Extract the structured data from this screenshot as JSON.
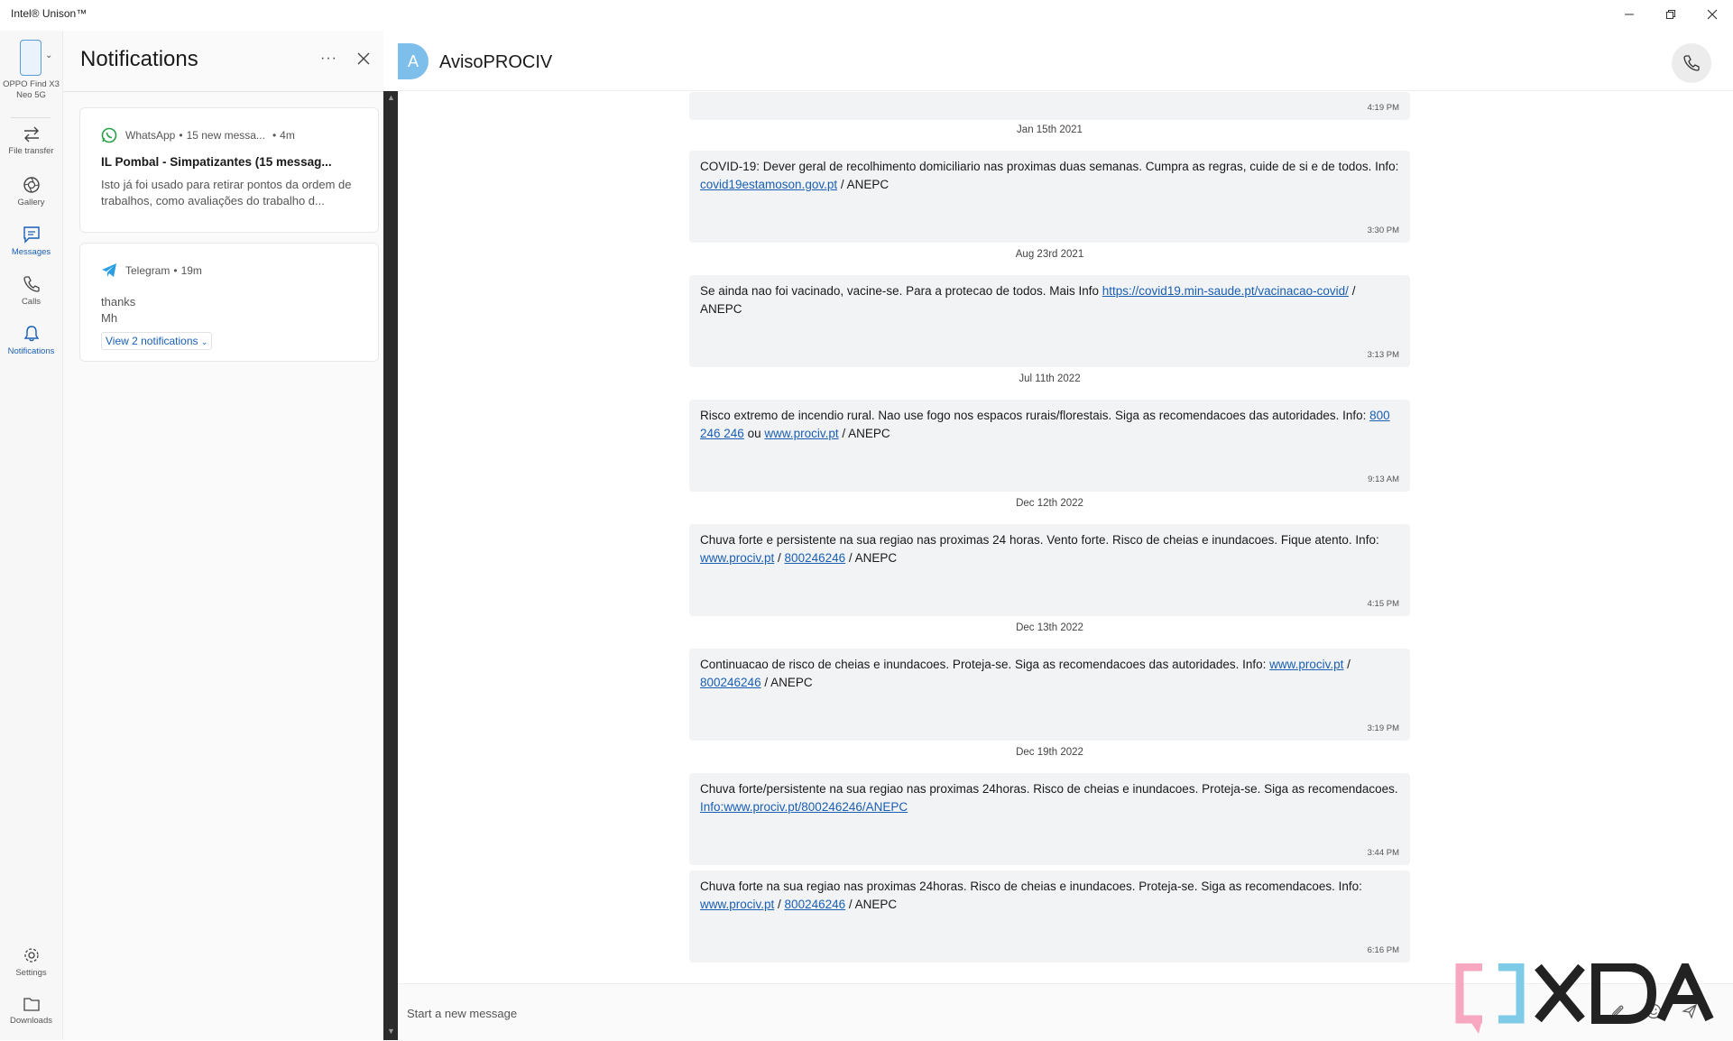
{
  "app": {
    "title": "Intel® Unison™"
  },
  "rail": {
    "phone_name": "OPPO Find X3 Neo 5G",
    "items": [
      {
        "label": "File transfer",
        "icon": "file-transfer-icon"
      },
      {
        "label": "Gallery",
        "icon": "gallery-icon"
      },
      {
        "label": "Messages",
        "icon": "messages-icon"
      },
      {
        "label": "Calls",
        "icon": "calls-icon"
      },
      {
        "label": "Notifications",
        "icon": "bell-icon"
      }
    ],
    "bottom": [
      {
        "label": "Settings",
        "icon": "settings-icon"
      },
      {
        "label": "Downloads",
        "icon": "folder-icon"
      }
    ]
  },
  "notifications": {
    "title": "Notifications",
    "more_label": "···",
    "items": [
      {
        "app": "WhatsApp",
        "meta": "15 new messa...",
        "time": "4m",
        "title": "IL Pombal - Simpatizantes (15 messag...",
        "body": "Isto já foi usado para retirar pontos da ordem de trabalhos, como avaliações do trabalho d..."
      },
      {
        "app": "Telegram",
        "time": "19m",
        "body_line1": "thanks",
        "body_line2": "Mh",
        "view_more": "View 2 notifications"
      }
    ]
  },
  "conversation": {
    "avatar_letter": "A",
    "contact": "AvisoPROCIV",
    "composer_placeholder": "Start a new message",
    "messages": [
      {
        "time": "4:19 PM"
      },
      {
        "date": "Jan 15th 2021",
        "pre": "COVID-19: Dever geral de recolhimento domiciliario nas proximas duas semanas. Cumpra as regras, cuide de si e de todos. Info: ",
        "link1": "covid19estamoson.gov.pt",
        "post": " / ANEPC",
        "time": "3:30 PM"
      },
      {
        "date": "Aug 23rd 2021",
        "pre": "Se ainda nao foi vacinado, vacine-se. Para a protecao de todos. Mais Info ",
        "link1": "https://covid19.min-saude.pt/vacinacao-covid/",
        "post": " / ANEPC",
        "time": "3:13 PM"
      },
      {
        "date": "Jul 11th 2022",
        "pre": "Risco extremo de incendio rural. Nao use fogo nos espacos rurais/florestais. Siga as recomendacoes das autoridades. Info: ",
        "link1": "800 246 246",
        "mid": " ou ",
        "link2": "www.prociv.pt",
        "post": " / ANEPC",
        "time": "9:13 AM"
      },
      {
        "date": "Dec 12th 2022",
        "pre": "Chuva forte e persistente na sua regiao nas proximas 24 horas. Vento forte. Risco de cheias e inundacoes. Fique atento. Info: ",
        "link1": "www.prociv.pt",
        "mid": " / ",
        "link2": "800246246",
        "post": " / ANEPC",
        "time": "4:15 PM"
      },
      {
        "date": "Dec 13th 2022",
        "pre": "Continuacao de risco de cheias e inundacoes. Proteja-se. Siga as recomendacoes das autoridades. Info: ",
        "link1": "www.prociv.pt",
        "mid": " / ",
        "link2": "800246246",
        "post": " / ANEPC",
        "time": "3:19 PM"
      },
      {
        "date": "Dec 19th 2022",
        "pre": "Chuva forte/persistente na sua regiao nas proximas 24horas. Risco de cheias e inundacoes. Proteja-se. Siga as recomendacoes. ",
        "link1": "Info:www.prociv.pt/800246246/ANEPC",
        "post": "",
        "time": "3:44 PM"
      },
      {
        "pre": "Chuva forte na sua regiao nas proximas 24horas. Risco de cheias e inundacoes. Proteja-se. Siga as recomendacoes. Info: ",
        "link1": "www.prociv.pt",
        "mid": " / ",
        "link2": "800246246",
        "post": " / ANEPC",
        "time": "6:16 PM"
      }
    ]
  },
  "watermark": {
    "text": "XDA",
    "colors": {
      "pink": "#f7a8c0",
      "blue": "#7ecbe8",
      "gray": "#222222"
    }
  }
}
